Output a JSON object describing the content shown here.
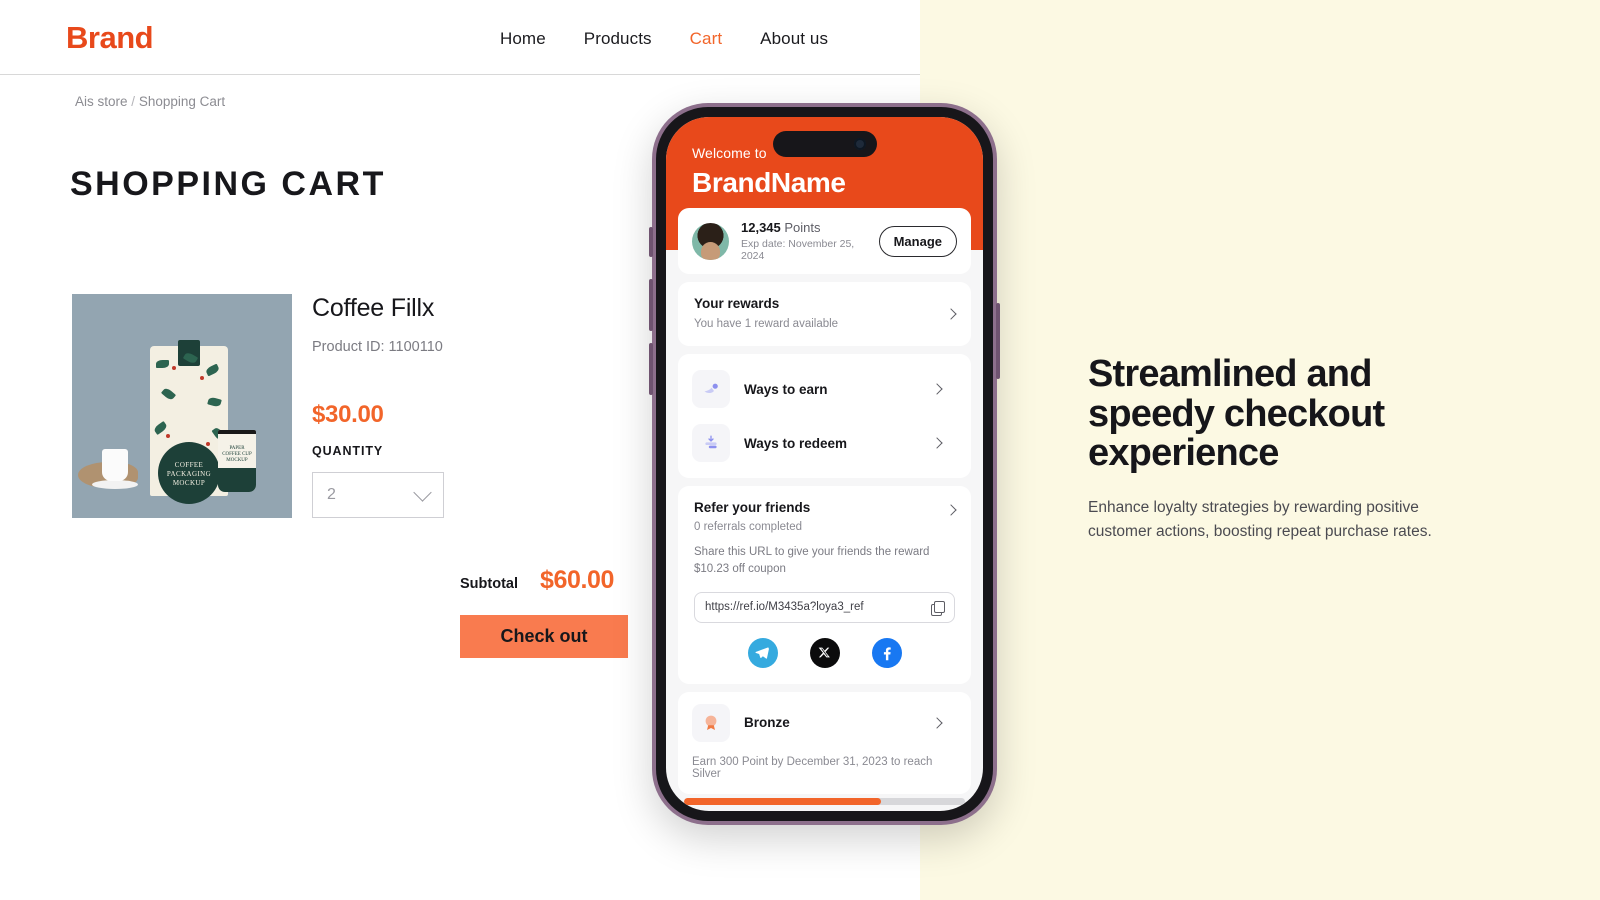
{
  "header": {
    "brand": "Brand",
    "nav": [
      {
        "label": "Home",
        "active": false
      },
      {
        "label": "Products",
        "active": false
      },
      {
        "label": "Cart",
        "active": true
      },
      {
        "label": "About us",
        "active": false
      }
    ]
  },
  "breadcrumb": {
    "root": "Ais store",
    "separator": "/",
    "current": "Shopping Cart"
  },
  "page": {
    "title": "SHOPPING CART"
  },
  "product": {
    "name": "Coffee Fillx",
    "id_label": "Product ID: 1100110",
    "price": "$30.00",
    "quantity_label": "QUANTITY",
    "quantity_value": "2",
    "image_alt": "coffee-packaging-mockup",
    "image_caption_line1": "COFFEE",
    "image_caption_line2": "PACKAGING",
    "image_caption_line3": "MOCKUP",
    "cup_caption_line1": "PAPER",
    "cup_caption_line2": "COFFEE CUP",
    "cup_caption_line3": "MOCKUP"
  },
  "totals": {
    "subtotal_label": "Subtotal",
    "subtotal_value": "$60.00",
    "checkout_label": "Check out"
  },
  "phone": {
    "welcome": "Welcome to",
    "brandname": "BrandName",
    "points": {
      "amount": "12,345",
      "unit": "Points",
      "expiry": "Exp date: November 25, 2024",
      "manage_label": "Manage"
    },
    "rewards": {
      "title": "Your rewards",
      "subtitle": "You have 1 reward available"
    },
    "ways": [
      {
        "label": "Ways to earn",
        "icon": "earn-icon"
      },
      {
        "label": "Ways to redeem",
        "icon": "redeem-icon"
      }
    ],
    "refer": {
      "title": "Refer your friends",
      "subtitle": "0 referrals completed",
      "description": "Share this URL to give your friends the reward $10.23 off coupon",
      "url": "https://ref.io/M3435a?loya3_ref",
      "socials": [
        {
          "name": "telegram",
          "label": "Telegram"
        },
        {
          "name": "x",
          "label": "X"
        },
        {
          "name": "facebook",
          "label": "Facebook"
        }
      ]
    },
    "tier": {
      "label": "Bronze",
      "note": "Earn 300 Point by December 31, 2023 to reach Silver",
      "progress_percent": 70
    }
  },
  "promo": {
    "title": "Streamlined and speedy checkout experience",
    "subtitle": "Enhance loyalty strategies by rewarding positive customer actions, boosting repeat purchase rates."
  },
  "colors": {
    "brand_orange": "#E8491B",
    "accent_orange": "#F2652A",
    "button_orange": "#F97B4F",
    "cream": "#FCF9E3",
    "phone_frame": "#8d6f8c"
  }
}
